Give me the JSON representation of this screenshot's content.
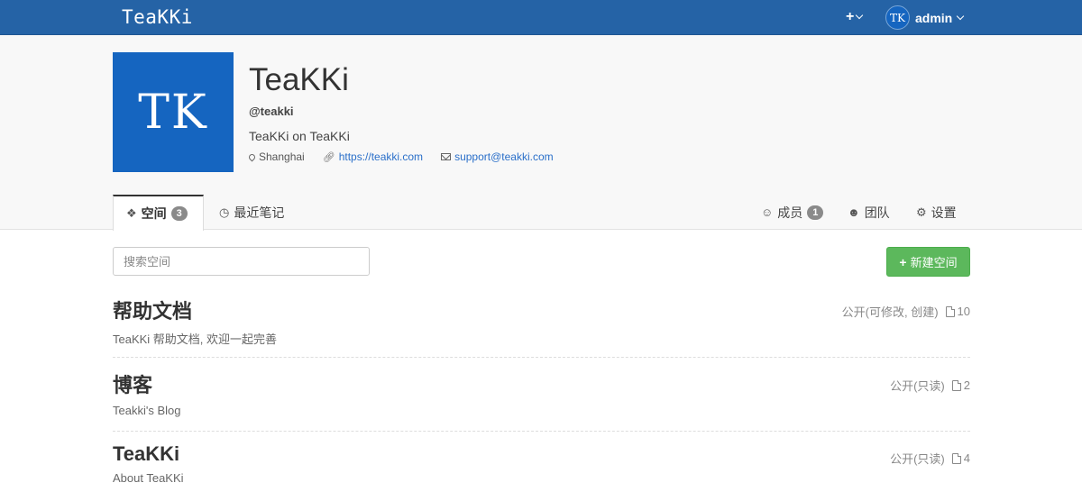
{
  "navbar": {
    "brand": "TeaKKi",
    "plus_label": "+",
    "avatar_text": "TK",
    "username": "admin"
  },
  "org": {
    "logo_text": "TK",
    "name": "TeaKKi",
    "handle": "@teakki",
    "description": "TeaKKi on TeaKKi",
    "location": "Shanghai",
    "url": "https://teakki.com",
    "email": "support@teakki.com",
    "logo_color": "#1565c0"
  },
  "tabs": {
    "spaces": {
      "label": "空间",
      "count": "3"
    },
    "recent": {
      "label": "最近笔记"
    },
    "members": {
      "label": "成员",
      "count": "1"
    },
    "team": {
      "label": "团队"
    },
    "settings": {
      "label": "设置"
    }
  },
  "toolbar": {
    "search_placeholder": "搜索空间",
    "new_space_label": "新建空间"
  },
  "spaces": [
    {
      "title": "帮助文档",
      "description": "TeaKKi 帮助文档, 欢迎一起完善",
      "visibility": "公开(可修改, 创建)",
      "docs": "10"
    },
    {
      "title": "博客",
      "description": "Teakki's Blog",
      "visibility": "公开(只读)",
      "docs": "2"
    },
    {
      "title": "TeaKKi",
      "description": "About TeaKKi",
      "visibility": "公开(只读)",
      "docs": "4"
    }
  ],
  "colors": {
    "navbar": "#2563a6",
    "primary_button": "#5cb85c",
    "link": "#2a6fc9"
  },
  "icons": [
    "plus-icon",
    "chevron-down-icon",
    "map-marker-icon",
    "link-icon",
    "envelope-icon",
    "cubes-icon",
    "clock-icon",
    "user-icon",
    "users-icon",
    "gear-icon",
    "file-icon"
  ]
}
